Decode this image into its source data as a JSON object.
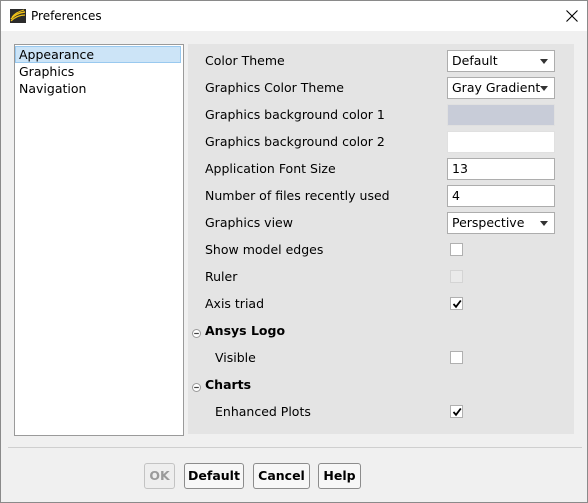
{
  "window": {
    "title": "Preferences"
  },
  "nav": {
    "items": [
      {
        "label": "Appearance",
        "selected": true
      },
      {
        "label": "Graphics",
        "selected": false
      },
      {
        "label": "Navigation",
        "selected": false
      }
    ]
  },
  "appearance": {
    "color_theme": {
      "label": "Color Theme",
      "value": "Default"
    },
    "graphics_color_theme": {
      "label": "Graphics Color Theme",
      "value": "Gray Gradient"
    },
    "bg_color_1": {
      "label": "Graphics background color 1",
      "color": "#c8ccd8"
    },
    "bg_color_2": {
      "label": "Graphics background color 2",
      "color": "#ffffff"
    },
    "font_size": {
      "label": "Application Font Size",
      "value": "13"
    },
    "recent_files": {
      "label": "Number of files recently used",
      "value": "4"
    },
    "graphics_view": {
      "label": "Graphics view",
      "value": "Perspective"
    },
    "show_model_edges": {
      "label": "Show model edges",
      "checked": false,
      "enabled": true
    },
    "ruler": {
      "label": "Ruler",
      "checked": false,
      "enabled": false
    },
    "axis_triad": {
      "label": "Axis triad",
      "checked": true,
      "enabled": true
    },
    "ansys_logo": {
      "label": "Ansys Logo",
      "visible": {
        "label": "Visible",
        "checked": false
      }
    },
    "charts": {
      "label": "Charts",
      "enhanced_plots": {
        "label": "Enhanced Plots",
        "checked": true
      }
    }
  },
  "buttons": {
    "ok": "OK",
    "default": "Default",
    "cancel": "Cancel",
    "help": "Help"
  },
  "colors": {
    "selection": "#cce4f7",
    "panel": "#e4e4e4"
  }
}
